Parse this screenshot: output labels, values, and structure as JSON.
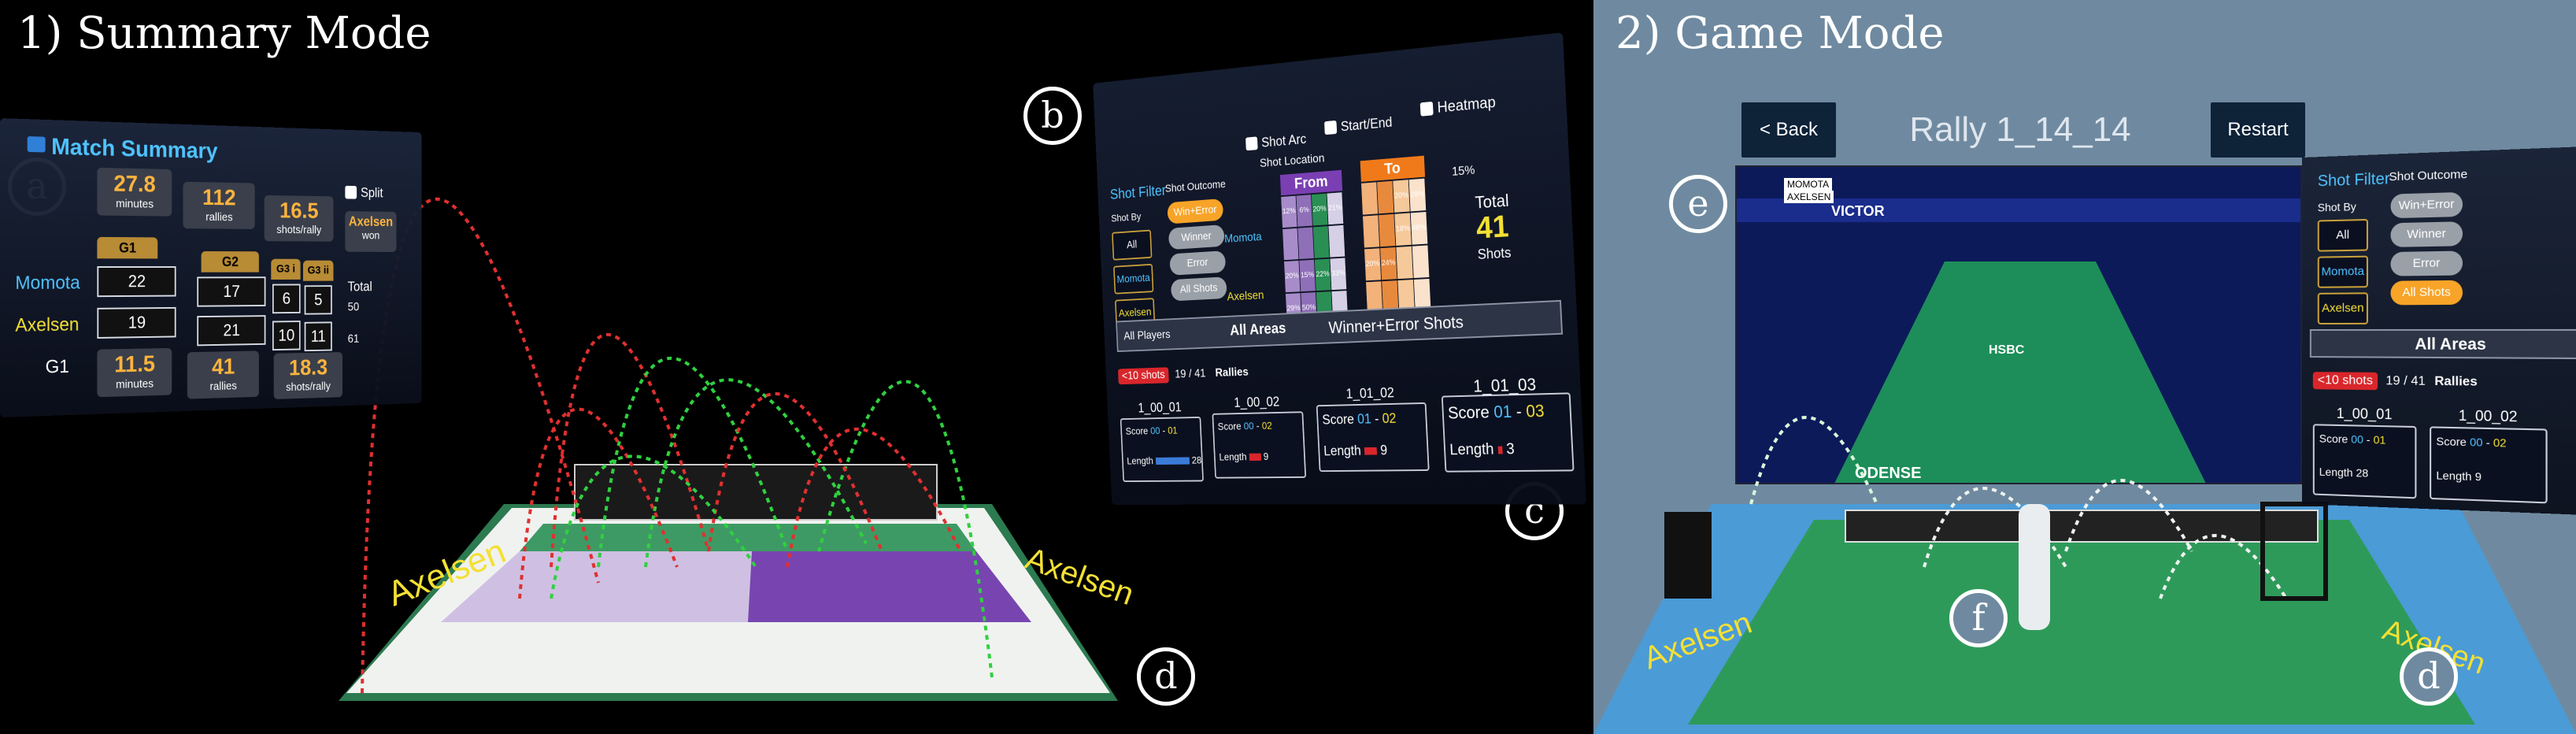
{
  "headings": {
    "summary": "1) Summary Mode",
    "game": "2) Game Mode"
  },
  "badges": {
    "a": "a",
    "b": "b",
    "c": "c",
    "d": "d",
    "e": "e",
    "f": "f"
  },
  "summary": {
    "title": "Match Summary",
    "split_label": "Split",
    "top_stats": [
      {
        "value": "27.8",
        "unit": "minutes"
      },
      {
        "value": "112",
        "unit": "rallies"
      },
      {
        "value": "16.5",
        "unit": "shots/rally"
      }
    ],
    "winner": {
      "name": "Axelsen",
      "label": "won"
    },
    "columns": [
      "G1",
      "G2",
      "G3 i",
      "G3 ii",
      "Total"
    ],
    "rows": [
      {
        "name": "Momota",
        "scores": [
          "22",
          "17",
          "6",
          "5",
          "50"
        ]
      },
      {
        "name": "Axelsen",
        "scores": [
          "19",
          "21",
          "10",
          "11",
          "61"
        ]
      }
    ],
    "game_label": "G1",
    "game_stats": [
      {
        "value": "11.5",
        "unit": "minutes"
      },
      {
        "value": "41",
        "unit": "rallies"
      },
      {
        "value": "18.3",
        "unit": "shots/rally"
      }
    ]
  },
  "court_labels": {
    "left": "Axelsen",
    "right": "Axelsen"
  },
  "filter": {
    "title": "Shot Filter",
    "shot_by_label": "Shot By",
    "shot_by": [
      "All",
      "Momota",
      "Axelsen"
    ],
    "outcome_label": "Shot Outcome",
    "outcomes": [
      "Win+Error",
      "Winner",
      "Error",
      "All Shots"
    ],
    "checks": [
      "Shot Arc",
      "Start/End",
      "Heatmap"
    ],
    "shot_location": "Shot Location",
    "from": "From",
    "to": "To",
    "percent": "15%",
    "heat_rows": [
      "Momota",
      "Axelsen"
    ],
    "heat_from": [
      "12%",
      "6%",
      "20%",
      "21%",
      "",
      "",
      "",
      "",
      "20%",
      "15%",
      "22%",
      "33%",
      "29%",
      "50%",
      "",
      ""
    ],
    "heat_to": [
      "",
      "",
      "20%",
      "29%",
      "",
      "",
      "18%",
      "48%",
      "20%",
      "24%",
      "",
      "",
      "",
      "",
      "",
      ""
    ],
    "total_label": "Total",
    "total_value": "41",
    "total_unit": "Shots",
    "bar": [
      "All Players",
      "All Areas",
      "Winner+Error Shots"
    ],
    "tag": "<10 shots",
    "rallies_count": "19 / 41",
    "rallies_label": "Rallies",
    "rallies": [
      {
        "id": "1_00_01",
        "score_a": "00",
        "score_b": "01",
        "length": "28",
        "length_pct": 0.9
      },
      {
        "id": "1_00_02",
        "score_a": "00",
        "score_b": "02",
        "length": "9",
        "length_pct": 0.3
      },
      {
        "id": "1_01_02",
        "score_a": "01",
        "score_b": "02",
        "length": "9",
        "length_pct": 0.3
      },
      {
        "id": "1_01_03",
        "score_a": "01",
        "score_b": "03",
        "length": "3",
        "length_pct": 0.1
      }
    ],
    "score_label": "Score",
    "length_label": "Length"
  },
  "game": {
    "back": "< Back",
    "title": "Rally 1_14_14",
    "restart": "Restart",
    "video_sponsors": [
      "VICTOR",
      "ODENSE",
      "HSBC"
    ],
    "players_overlay": [
      "MOMOTA",
      "AXELSEN"
    ]
  },
  "side_panel": {
    "title": "Shot Filter",
    "shot_by_label": "Shot By",
    "shot_by": [
      "All",
      "Momota",
      "Axelsen"
    ],
    "outcome_label": "Shot Outcome",
    "outcomes": [
      "Win+Error",
      "Winner",
      "Error",
      "All Shots"
    ],
    "area": "All Areas",
    "tag": "<10 shots",
    "rallies_count": "19 / 41",
    "rallies_label": "Rallies",
    "rallies": [
      {
        "id": "1_00_01",
        "score_a": "00",
        "score_b": "01",
        "length": "28"
      },
      {
        "id": "1_00_02",
        "score_a": "00",
        "score_b": "02",
        "length": "9"
      }
    ]
  },
  "colors": {
    "gold": "#ffb43d",
    "blue": "#4fc3ff",
    "court_green": "#2e9a5a",
    "arc_red": "#e03030",
    "arc_green": "#30d040"
  }
}
